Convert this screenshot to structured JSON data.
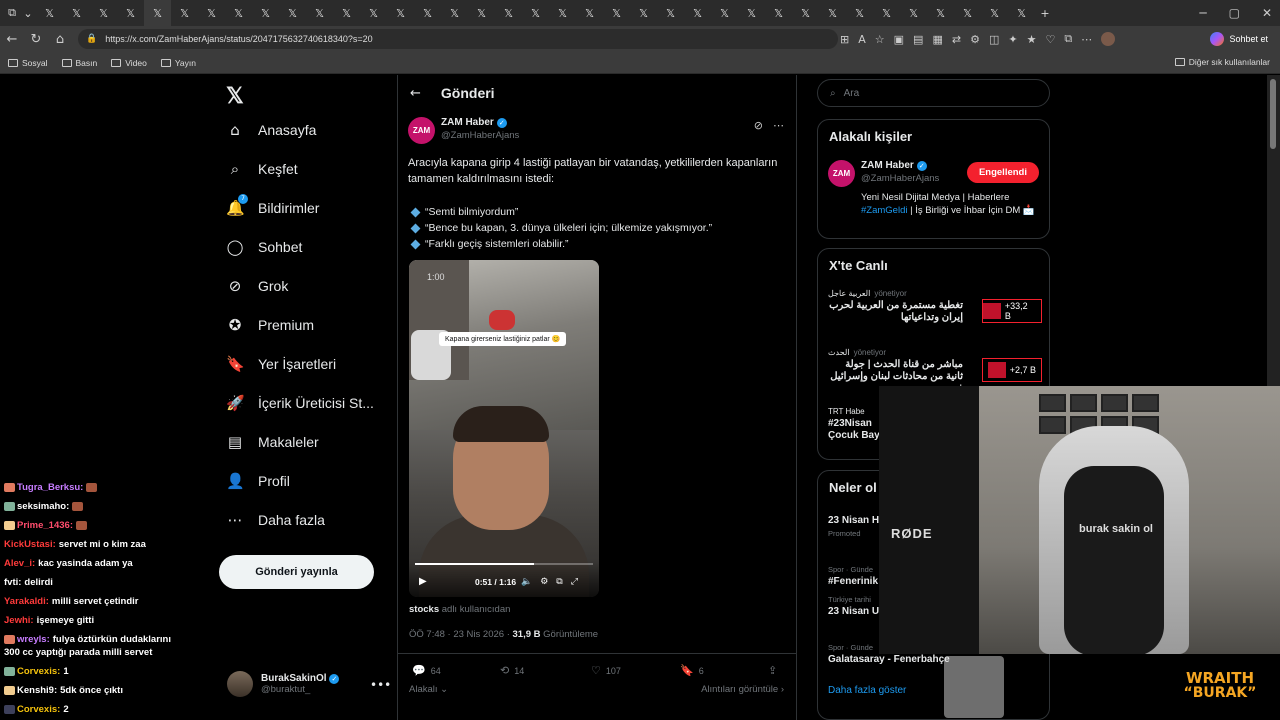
{
  "browser": {
    "url": "https://x.com/ZamHaberAjans/status/2047175632740618340?s=20",
    "tab_icons": [
      "x-icon",
      "x-icon",
      "x-icon",
      "x-icon",
      "x-icon",
      "x-icon",
      "x-icon",
      "x-icon",
      "x-icon",
      "x-icon",
      "x-icon",
      "x-icon",
      "x-icon",
      "x-icon",
      "x-icon",
      "x-icon",
      "x-icon",
      "x-icon",
      "x-icon",
      "x-icon",
      "x-icon",
      "x-icon",
      "x-icon",
      "x-icon",
      "x-icon",
      "x-icon",
      "x-icon",
      "x-icon",
      "x-icon",
      "x-icon",
      "x-icon",
      "x-icon",
      "x-icon",
      "x-icon",
      "x-icon",
      "x-icon",
      "x-icon"
    ],
    "copilot_label": "Sohbet et",
    "bookmarks": [
      "Sosyal",
      "Basın",
      "Video",
      "Yayın"
    ],
    "bookmarks_other": "Diğer sık kullanılanlar"
  },
  "nav": {
    "items": [
      {
        "label": "Anasayfa",
        "icon": "home-icon"
      },
      {
        "label": "Keşfet",
        "icon": "search-icon"
      },
      {
        "label": "Bildirimler",
        "icon": "bell-icon",
        "badge": "7"
      },
      {
        "label": "Sohbet",
        "icon": "chat-icon"
      },
      {
        "label": "Grok",
        "icon": "grok-icon"
      },
      {
        "label": "Premium",
        "icon": "premium-icon"
      },
      {
        "label": "Yer İşaretleri",
        "icon": "bookmark-icon"
      },
      {
        "label": "İçerik Üreticisi St...",
        "icon": "rocket-icon"
      },
      {
        "label": "Makaleler",
        "icon": "article-icon"
      },
      {
        "label": "Profil",
        "icon": "profile-icon"
      },
      {
        "label": "Daha fazla",
        "icon": "more-icon"
      }
    ],
    "post_button": "Gönderi yayınla",
    "me_name": "BurakSakinOl",
    "me_handle": "@buraktut_"
  },
  "main": {
    "header_title": "Gönderi",
    "author_name": "ZAM Haber",
    "author_handle": "@ZamHaberAjans",
    "avatar_text": "ZAM",
    "text": "Aracıyla kapana girip 4 lastiği patlayan bir vatandaş, yetkililerden kapanların tamamen kaldırılmasını istedi:",
    "bullets": [
      "“Semti bilmiyordum”",
      "“Bence bu kapan, 3. dünya ülkeleri için; ülkemize yakışmıyor.”",
      "“Farklı geçiş sistemleri olabilir.”"
    ],
    "video": {
      "top_time": "1:00",
      "caption": "Kapana girerseniz lastiğiniz patlar 😊",
      "duration": "0:51 / 1:16",
      "progress": 0.67
    },
    "from_user": "stocks",
    "from_suffix": "adlı kullanıcıdan",
    "time": "ÖÖ 7:48 · 23 Nis 2026 · ",
    "views": "31,9 B",
    "views_label": "Görüntüleme",
    "replies": "64",
    "reposts": "14",
    "likes": "107",
    "bookmarks": "6",
    "related": "Alakalı",
    "quotes": "Alıntıları görüntüle"
  },
  "right": {
    "search_placeholder": "Ara",
    "related_title": "Alakalı kişiler",
    "rel_name": "ZAM Haber",
    "rel_handle": "@ZamHaberAjans",
    "block_label": "Engellendi",
    "rel_bio_1": "Yeni Nesil Dijital Medya | Haberlere ",
    "rel_bio_tag": "#ZamGeldi",
    "rel_bio_2": " | İş Birliği ve İhbar İçin DM 📩",
    "live_title": "X'te Canlı",
    "live": [
      {
        "source": "العربية عاجل",
        "status": "yönetiyor",
        "title": "تغطية مستمرة من العربية لحرب إيران وتداعياتها",
        "count": "+33,2 B"
      },
      {
        "source": "الحدث",
        "status": "yönetiyor",
        "title": "مباشر من قناة الحدث | جولة ثانية من محادثات لبنان وإسرائيل في ...",
        "count": "+2,7 B"
      },
      {
        "source": "TRT Habe",
        "title": "#23Nisan Çocuk Bay"
      }
    ],
    "whats_title": "Neler ol",
    "trends": [
      {
        "meta": "",
        "title": "23 Nisan H",
        "sub": "Promoted"
      },
      {
        "meta": "Spor · Günde",
        "title": "#Fenerinik"
      },
      {
        "meta": "Türkiye tarihi",
        "title": "23 Nisan U"
      },
      {
        "meta": "Spor · Günde",
        "title": "Galatasaray - Fenerbahçe"
      }
    ],
    "show_more": "Daha fazla göster"
  },
  "chat": [
    {
      "user": "Tugra_Berksu:",
      "color": "#c77dff",
      "msg": ""
    },
    {
      "user": "seksimaho:",
      "color": "#ffffff",
      "msg": ""
    },
    {
      "user": "Prime_1436:",
      "color": "#ff4d6d",
      "msg": ""
    },
    {
      "user": "KickUstasi:",
      "color": "#ff3b3b",
      "msg": "servet mi o kim zaa"
    },
    {
      "user": "Alev_i:",
      "color": "#ff3b3b",
      "msg": "kac yasinda adam ya"
    },
    {
      "user": "fvti:",
      "color": "#ffffff",
      "msg": "delirdi"
    },
    {
      "user": "Yarakaldi:",
      "color": "#ff3b3b",
      "msg": "milli servet çetindir"
    },
    {
      "user": "Jewhi:",
      "color": "#ff3b3b",
      "msg": "işemeye gitti"
    },
    {
      "user": "wreyls:",
      "color": "#c77dff",
      "msg": "fulya öztürkün dudaklarını 300 cc yaptığı parada milli servet"
    },
    {
      "user": "Corvexis:",
      "color": "#f4c20d",
      "msg": "1"
    },
    {
      "user": "Kenshi9:",
      "color": "#ffffff",
      "msg": "5dk önce çıktı"
    },
    {
      "user": "Corvexis:",
      "color": "#f4c20d",
      "msg": "2"
    }
  ],
  "overlay": {
    "mic_brand": "RØDE",
    "chair_brand": "burak sakin ol",
    "brand_1": "WRAITH",
    "brand_2": "“BURAK”"
  }
}
